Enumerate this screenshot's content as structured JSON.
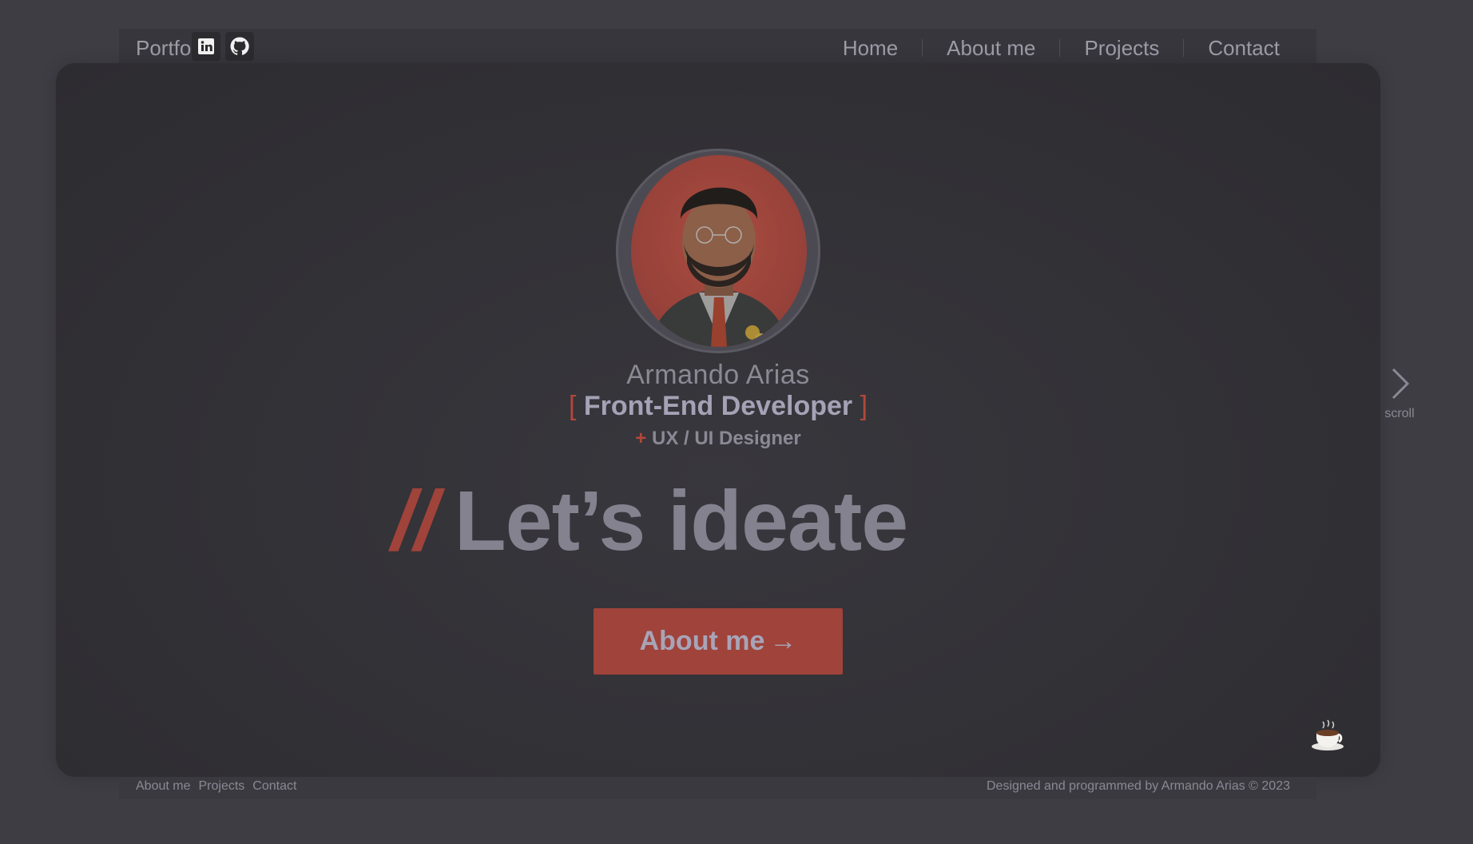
{
  "header": {
    "brand": "Portfolio",
    "social": [
      {
        "icon": "linkedin-icon"
      },
      {
        "icon": "github-icon"
      }
    ],
    "nav": [
      {
        "label": "Home",
        "active": true
      },
      {
        "label": "About me",
        "active": false
      },
      {
        "label": "Projects",
        "active": false
      },
      {
        "label": "Contact",
        "active": false
      }
    ]
  },
  "hero": {
    "name": "Armando Arias",
    "role_open": "[",
    "role": "Front-End Developer",
    "role_close": "]",
    "sub_plus": "+",
    "sub": "UX / UI Designer",
    "headline_prefix": "//",
    "headline": "Let’s ideate",
    "cta_label": "About me",
    "cta_arrow": "→"
  },
  "scroll": {
    "label": "scroll",
    "icon": "chevron-right-icon"
  },
  "coffee": {
    "icon": "coffee-cup-icon"
  },
  "footer": {
    "links": [
      "About me",
      "Projects",
      "Contact"
    ],
    "credit": "Designed and programmed by Armando Arias © 2023"
  },
  "colors": {
    "accent": "#b2473b",
    "background": "#3e3d44",
    "card": "#302f34",
    "text_muted": "#9d9ba6"
  }
}
